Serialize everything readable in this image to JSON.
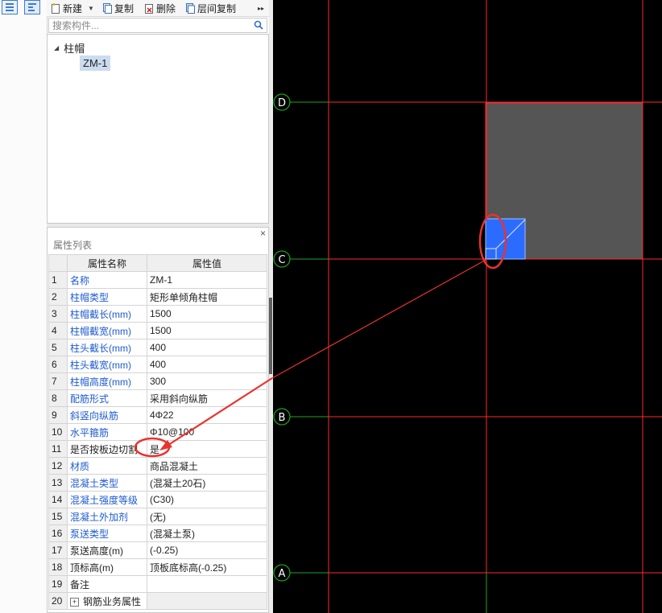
{
  "toolbar": {
    "new_label": "新建",
    "copy_label": "复制",
    "delete_label": "删除",
    "floor_copy_label": "层间复制",
    "more_glyph": "▸▸"
  },
  "search": {
    "placeholder": "搜索构件..."
  },
  "tree": {
    "root_label": "柱帽",
    "child_label": "ZM-1"
  },
  "property_panel": {
    "title": "属性列表",
    "close_glyph": "×",
    "columns": [
      "属性名称",
      "属性值"
    ],
    "rows": [
      {
        "n": "1",
        "name": "名称",
        "value": "ZM-1",
        "blue": true
      },
      {
        "n": "2",
        "name": "柱帽类型",
        "value": "矩形单倾角柱帽",
        "blue": true
      },
      {
        "n": "3",
        "name": "柱帽截长(mm)",
        "value": "1500",
        "blue": true
      },
      {
        "n": "4",
        "name": "柱帽截宽(mm)",
        "value": "1500",
        "blue": true
      },
      {
        "n": "5",
        "name": "柱头截长(mm)",
        "value": "400",
        "blue": true
      },
      {
        "n": "6",
        "name": "柱头截宽(mm)",
        "value": "400",
        "blue": true
      },
      {
        "n": "7",
        "name": "柱帽高度(mm)",
        "value": "300",
        "blue": true
      },
      {
        "n": "8",
        "name": "配筋形式",
        "value": "采用斜向纵筋",
        "blue": true
      },
      {
        "n": "9",
        "name": "斜竖向纵筋",
        "value": "4Φ22",
        "blue": true
      },
      {
        "n": "10",
        "name": "水平箍筋",
        "value": "Φ10@100",
        "blue": true
      },
      {
        "n": "11",
        "name": "是否按板边切割",
        "value": "是",
        "blue": false
      },
      {
        "n": "12",
        "name": "材质",
        "value": "商品混凝土",
        "blue": true
      },
      {
        "n": "13",
        "name": "混凝土类型",
        "value": "(混凝土20石)",
        "blue": true
      },
      {
        "n": "14",
        "name": "混凝土强度等级",
        "value": "(C30)",
        "blue": true
      },
      {
        "n": "15",
        "name": "混凝土外加剂",
        "value": "(无)",
        "blue": true
      },
      {
        "n": "16",
        "name": "泵送类型",
        "value": "(混凝土泵)",
        "blue": true
      },
      {
        "n": "17",
        "name": "泵送高度(m)",
        "value": "(-0.25)",
        "blue": false
      },
      {
        "n": "18",
        "name": "顶标高(m)",
        "value": "顶板底标高(-0.25)",
        "blue": false
      },
      {
        "n": "19",
        "name": "备注",
        "value": "",
        "blue": false
      },
      {
        "n": "20",
        "name": "钢筋业务属性",
        "value": "",
        "blue": false,
        "expandable": true
      }
    ]
  },
  "canvas": {
    "axis_labels": [
      "D",
      "C",
      "B",
      "A"
    ],
    "background": "#000000",
    "grid_line_color": "#ff2a2a",
    "axis_line_color": "#1fa31f",
    "slab_color": "#555555",
    "column_cap_color": "#2b6bff",
    "annotation_color": "#e8332f"
  }
}
